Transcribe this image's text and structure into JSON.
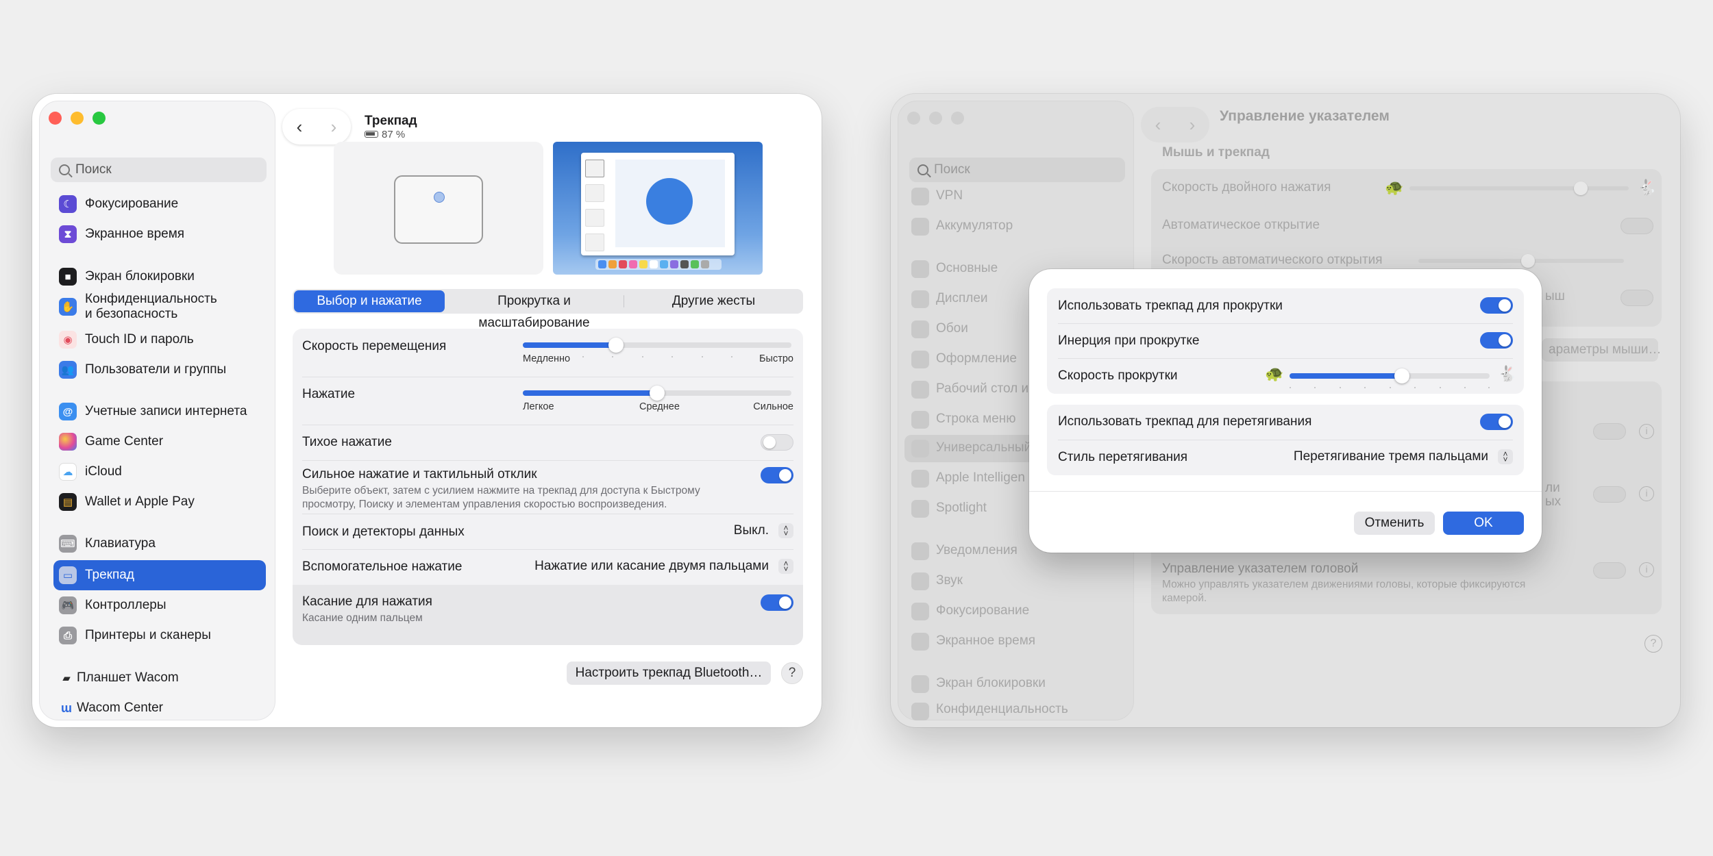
{
  "left_window": {
    "sidebar": {
      "search_placeholder": "Поиск",
      "items": [
        {
          "label": "Фокусирование",
          "icon": "moon-icon",
          "color": "#5b4bd4"
        },
        {
          "label": "Экранное время",
          "icon": "hourglass-icon",
          "color": "#6d4bd6"
        },
        {
          "label": "Экран блокировки",
          "icon": "lock-icon",
          "color": "#1d1d1f"
        },
        {
          "label": "Конфиденциальность",
          "label2": "и безопасность",
          "icon": "hand-icon",
          "color": "#3b7be8"
        },
        {
          "label": "Touch ID и пароль",
          "icon": "fingerprint-icon",
          "color": "#f0f0f0"
        },
        {
          "label": "Пользователи и группы",
          "icon": "users-icon",
          "color": "#3b7be8"
        },
        {
          "label": "Учетные записи интернета",
          "icon": "at-icon",
          "color": "#3b8ff0"
        },
        {
          "label": "Game Center",
          "icon": "game-center-icon",
          "color": "#e24b9a"
        },
        {
          "label": "iCloud",
          "icon": "cloud-icon",
          "color": "#ffffff"
        },
        {
          "label": "Wallet и Apple Pay",
          "icon": "wallet-icon",
          "color": "#1d1d1f"
        },
        {
          "label": "Клавиатура",
          "icon": "keyboard-icon",
          "color": "#9a9a9e"
        },
        {
          "label": "Трекпад",
          "icon": "trackpad-icon",
          "color": "#9a9a9e"
        },
        {
          "label": "Контроллеры",
          "icon": "gamepad-icon",
          "color": "#9a9a9e"
        },
        {
          "label": "Принтеры и сканеры",
          "icon": "printer-icon",
          "color": "#9a9a9e"
        },
        {
          "label": "Планшет Wacom",
          "icon": "tablet-icon",
          "color": "#2c2c2c"
        },
        {
          "label": "Wacom Center",
          "icon": "wacom-icon",
          "color": "#2f6ae0"
        }
      ]
    },
    "header": {
      "back": "‹",
      "forward": "›",
      "title": "Трекпад",
      "battery": "87 %"
    },
    "tabs": [
      "Выбор и нажатие",
      "Прокрутка и масштабирование",
      "Другие жесты"
    ],
    "settings": {
      "tracking_speed": {
        "label": "Скорость перемещения",
        "min": "Медленно",
        "max": "Быстро",
        "value": 0.35
      },
      "click": {
        "label": "Нажатие",
        "min": "Легкое",
        "mid": "Среднее",
        "max": "Сильное",
        "value": 0.5
      },
      "silent_click": {
        "label": "Тихое нажатие",
        "on": false
      },
      "force_click": {
        "label": "Сильное нажатие и тактильный отклик",
        "desc1": "Выберите объект, затем с усилием нажмите на трекпад для доступа к Быстрому",
        "desc2": "просмотру, Поиску и элементам управления скоростью воспроизведения.",
        "on": true
      },
      "lookup": {
        "label": "Поиск и детекторы данных",
        "value": "Выкл."
      },
      "secondary_click": {
        "label": "Вспомогательное нажатие",
        "value": "Нажатие или касание двумя пальцами"
      },
      "tap_to_click": {
        "label": "Касание для нажатия",
        "sub": "Касание одним пальцем",
        "on": true
      }
    },
    "bluetooth_button": "Настроить трекпад Bluetooth…",
    "help": "?"
  },
  "right_window": {
    "title": "Управление указателем",
    "search_placeholder": "Поиск",
    "sidebar_items": [
      "VPN",
      "Аккумулятор",
      "Основные",
      "Дисплеи",
      "Обои",
      "Оформление",
      "Рабочий стол и",
      "Строка меню",
      "Универсальный",
      "Apple Intelligen",
      "Spotlight",
      "Уведомления",
      "Звук",
      "Фокусирование",
      "Экранное время",
      "Экран блокировки",
      "Конфиденциальность"
    ],
    "section": "Мышь и трекпад",
    "rows": [
      "Скорость двойного нажатия",
      "Автоматическое открытие",
      "Скорость автоматического открытия"
    ],
    "partial_1": "ыш",
    "partial_btn": "араметры мыши…",
    "partial_2": "ли",
    "partial_3": "ых",
    "head_pointer": {
      "label": "Управление указателем головой",
      "desc1": "Можно управлять указателем движениями головы, которые фиксируются",
      "desc2": "камерой."
    },
    "help": "?",
    "info": "i"
  },
  "dialog": {
    "use_scroll": {
      "label": "Использовать трекпад для прокрутки",
      "on": true
    },
    "inertia": {
      "label": "Инерция при прокрутке",
      "on": true
    },
    "scroll_speed": {
      "label": "Скорость прокрутки",
      "value": 0.56
    },
    "use_drag": {
      "label": "Использовать трекпад для перетягивания",
      "on": true
    },
    "drag_style": {
      "label": "Стиль перетягивания",
      "value": "Перетягивание тремя пальцами"
    },
    "cancel": "Отменить",
    "ok": "OK"
  }
}
